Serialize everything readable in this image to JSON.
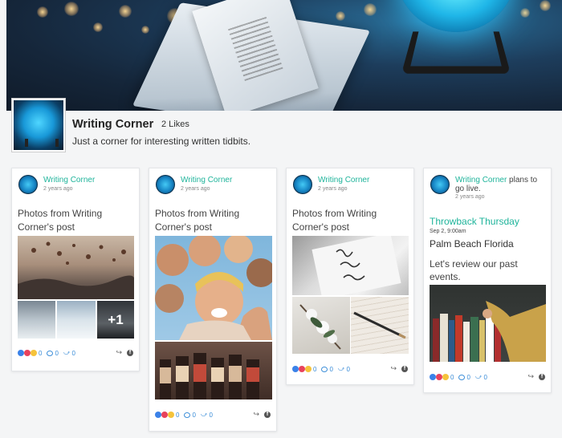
{
  "page": {
    "name": "Writing Corner",
    "likes": "2 Likes",
    "description": "Just a corner for interesting written tidbits."
  },
  "posts": [
    {
      "author": "Writing Corner",
      "time": "2 years ago",
      "text": "Photos from Writing Corner's post",
      "more_photos": "+1",
      "reactions_count": "0",
      "comments_count": "0",
      "shares_count": "0"
    },
    {
      "author": "Writing Corner",
      "time": "2 years ago",
      "text": "Photos from Writing Corner's post",
      "reactions_count": "0",
      "comments_count": "0",
      "shares_count": "0"
    },
    {
      "author": "Writing Corner",
      "time": "2 years ago",
      "text": "Photos from Writing Corner's post",
      "reactions_count": "0",
      "comments_count": "0",
      "shares_count": "0"
    },
    {
      "author": "Writing Corner",
      "author_suffix": " plans to go live.",
      "time": "2 years ago",
      "event_title": "Throwback Thursday",
      "event_date": "Sep 2, 9:00am",
      "event_location": "Palm Beach Florida",
      "event_description": "Let's review our past events.",
      "reactions_count": "0",
      "comments_count": "0",
      "shares_count": "0"
    }
  ],
  "colors": {
    "accent": "#1fb49b",
    "reaction_blue": "#3b8dd8"
  },
  "icons": [
    "like-reaction-icon",
    "love-reaction-icon",
    "haha-reaction-icon",
    "comment-icon",
    "share-icon",
    "facebook-icon"
  ]
}
